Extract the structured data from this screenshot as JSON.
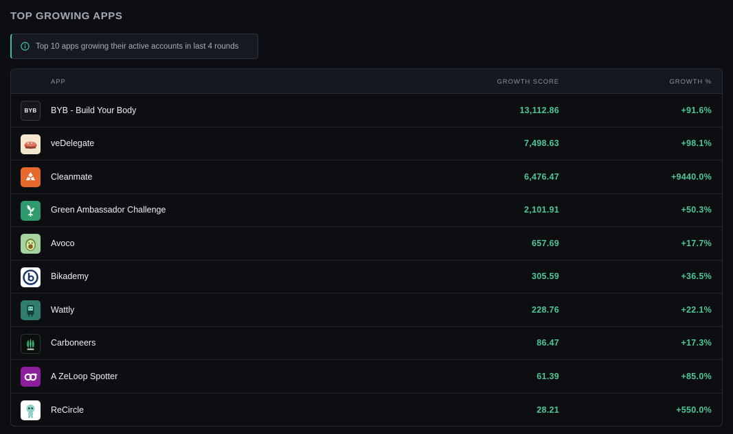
{
  "page": {
    "title": "TOP GROWING APPS",
    "info": "Top 10 apps growing their active accounts in last 4 rounds"
  },
  "table": {
    "headers": {
      "app": "APP",
      "score": "GROWTH SCORE",
      "growth": "GROWTH %"
    },
    "rows": [
      {
        "name": "BYB - Build Your Body",
        "score": "13,112.86",
        "growth": "+91.6%",
        "logo_text": "BYB",
        "logo_icon": "byb-logo-icon"
      },
      {
        "name": "veDelegate",
        "score": "7,498.63",
        "growth": "+98.1%",
        "logo_icon": "vedelegate-logo-icon"
      },
      {
        "name": "Cleanmate",
        "score": "6,476.47",
        "growth": "+9440.0%",
        "logo_icon": "cleanmate-recycle-logo-icon"
      },
      {
        "name": "Green Ambassador Challenge",
        "score": "2,101.91",
        "growth": "+50.3%",
        "logo_icon": "green-ambassador-leaf-logo-icon"
      },
      {
        "name": "Avoco",
        "score": "657.69",
        "growth": "+17.7%",
        "logo_icon": "avocado-logo-icon"
      },
      {
        "name": "Bikademy",
        "score": "305.59",
        "growth": "+36.5%",
        "logo_icon": "bikademy-logo-icon"
      },
      {
        "name": "Wattly",
        "score": "228.76",
        "growth": "+22.1%",
        "logo_icon": "wattly-logo-icon"
      },
      {
        "name": "Carboneers",
        "score": "86.47",
        "growth": "+17.3%",
        "logo_icon": "carboneers-logo-icon"
      },
      {
        "name": "A ZeLoop Spotter",
        "score": "61.39",
        "growth": "+85.0%",
        "logo_icon": "zeloop-logo-icon"
      },
      {
        "name": "ReCircle",
        "score": "28.21",
        "growth": "+550.0%",
        "logo_icon": "recircle-mascot-logo-icon"
      }
    ]
  },
  "colors": {
    "accent_green": "#4cc796",
    "background": "#0d0e12",
    "header_bg": "#151820"
  }
}
